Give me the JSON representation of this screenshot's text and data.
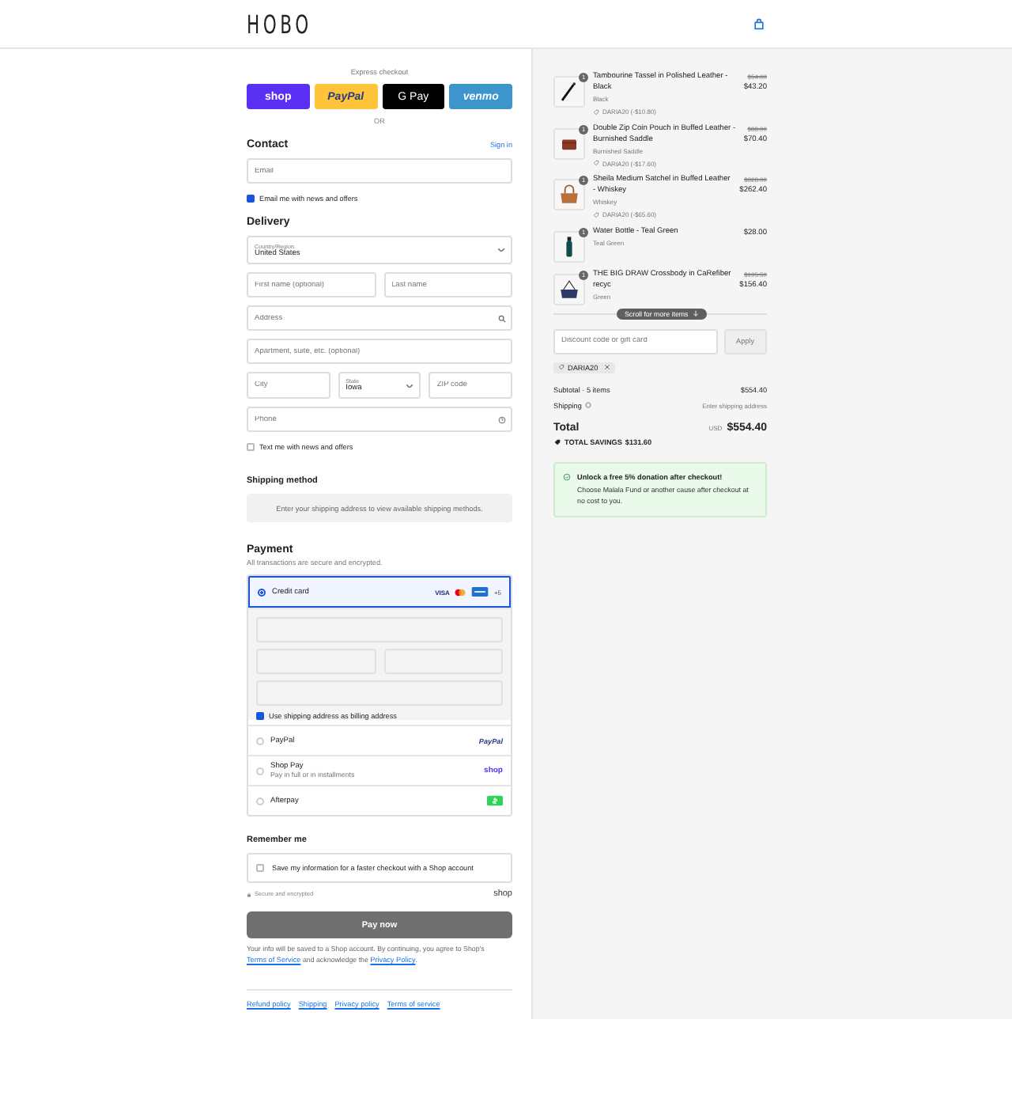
{
  "header": {
    "logo": "HOBO"
  },
  "express": {
    "label": "Express checkout",
    "separator": "OR",
    "buttons": [
      {
        "kind": "shop",
        "label": "shop"
      },
      {
        "kind": "paypal",
        "label": "PayPal"
      },
      {
        "kind": "gpay",
        "label": "G Pay"
      },
      {
        "kind": "venmo",
        "label": "venmo"
      }
    ]
  },
  "contact": {
    "heading": "Contact",
    "sign_in": "Sign in",
    "email": {
      "placeholder": "Email"
    },
    "news": {
      "label": "Email me with news and offers",
      "checked": true
    }
  },
  "delivery": {
    "heading": "Delivery",
    "country": {
      "label": "Country/Region",
      "value": "United States"
    },
    "first_name": {
      "placeholder": "First name (optional)"
    },
    "last_name": {
      "placeholder": "Last name"
    },
    "address": {
      "placeholder": "Address"
    },
    "apartment": {
      "placeholder": "Apartment, suite, etc. (optional)"
    },
    "city": {
      "placeholder": "City"
    },
    "state": {
      "label": "State",
      "value": "Iowa"
    },
    "zip": {
      "placeholder": "ZIP code"
    },
    "phone": {
      "placeholder": "Phone"
    },
    "text_me": {
      "label": "Text me with news and offers",
      "checked": false
    }
  },
  "shipping_method": {
    "heading": "Shipping method",
    "message": "Enter your shipping address to view available shipping methods."
  },
  "payment": {
    "heading": "Payment",
    "subtitle": "All transactions are secure and encrypted.",
    "billing": {
      "label": "Use shipping address as billing address",
      "checked": true
    },
    "methods": [
      {
        "kind": "card",
        "label": "Credit card",
        "selected": true,
        "visa": "VISA",
        "more": "+5"
      },
      {
        "kind": "paypal",
        "label": "PayPal",
        "selected": false,
        "brand": "PayPal"
      },
      {
        "kind": "shoppay",
        "label": "Shop Pay",
        "sub": "Pay in full or in installments",
        "selected": false,
        "brand": "shop"
      },
      {
        "kind": "afterpay",
        "label": "Afterpay",
        "selected": false
      }
    ]
  },
  "remember": {
    "heading": "Remember me",
    "save": {
      "label": "Save my information for a faster checkout with a Shop account",
      "checked": false
    },
    "secure": "Secure and encrypted",
    "brand": "shop"
  },
  "pay_button": "Pay now",
  "legal": {
    "before": "Your info will be saved to a Shop account. By continuing, you agree to Shop's ",
    "terms": "Terms of Service",
    "middle": " and acknowledge the ",
    "privacy": "Privacy Policy",
    "after": "."
  },
  "footer_links": [
    "Refund policy",
    "Shipping",
    "Privacy policy",
    "Terms of service"
  ],
  "summary": {
    "items": [
      {
        "kind": "tassel",
        "quantity": "1",
        "title": "Tambourine Tassel in Polished Leather - Black",
        "variant": "Black",
        "discount": "DARIA20 (-$10.80)",
        "original_price": "$54.00",
        "price": "$43.20"
      },
      {
        "kind": "pouch",
        "quantity": "1",
        "title": "Double Zip Coin Pouch in Buffed Leather - Burnished Saddle",
        "variant": "Burnished Saddle",
        "discount": "DARIA20 (-$17.60)",
        "original_price": "$88.00",
        "price": "$70.40"
      },
      {
        "kind": "satchel",
        "quantity": "1",
        "title": "Sheila Medium Satchel in Buffed Leather - Whiskey",
        "variant": "Whiskey",
        "discount": "DARIA20 (-$65.60)",
        "original_price": "$328.00",
        "price": "$262.40"
      },
      {
        "kind": "bottle",
        "quantity": "1",
        "title": "Water Bottle - Teal Green",
        "variant": "Teal Green",
        "price": "$28.00"
      },
      {
        "kind": "crossbody",
        "quantity": "1",
        "title": "THE BIG DRAW Crossbody in CaRefiber recyc",
        "variant": "Green",
        "original_price": "$195.50",
        "price": "$156.40"
      }
    ],
    "scroll_hint": "Scroll for more items",
    "discount_field": {
      "placeholder": "Discount code or gift card"
    },
    "apply": "Apply",
    "applied_code": "DARIA20",
    "subtotal": {
      "label": "Subtotal · 5 items",
      "value": "$554.40"
    },
    "shipping": {
      "label": "Shipping",
      "value": "Enter shipping address"
    },
    "total": {
      "label": "Total",
      "currency": "USD",
      "value": "$554.40"
    },
    "savings": {
      "label": "TOTAL SAVINGS",
      "value": "$131.60"
    },
    "donation": {
      "title": "Unlock a free 5% donation after checkout!",
      "body": "Choose Malala Fund or another cause after checkout at no cost to you."
    }
  }
}
